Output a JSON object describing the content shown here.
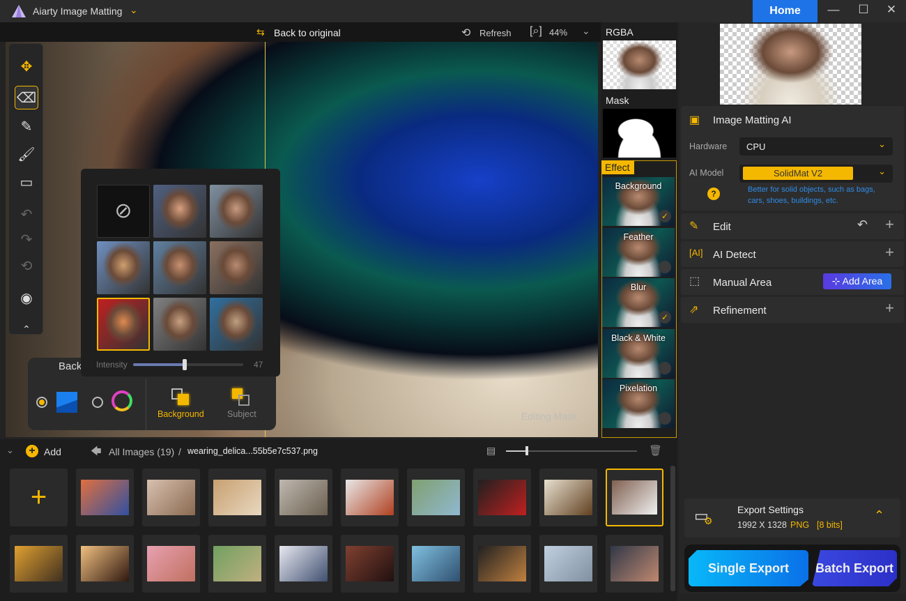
{
  "app": {
    "title": "Aiarty Image Matting",
    "home": "Home",
    "accent": "#f5b800",
    "home_color": "#1e74e6"
  },
  "canvas_bar": {
    "back": "Back to original",
    "refresh": "Refresh",
    "zoom": "44%"
  },
  "canvas": {
    "watermark": "Editing Mask"
  },
  "effect_popup": {
    "intensity_label": "Intensity",
    "intensity_value": "47",
    "intensity_fraction": 0.47
  },
  "bg_panel": {
    "title": "Back",
    "background": "Background",
    "subject": "Subject"
  },
  "effects": {
    "rgba": "RGBA",
    "mask": "Mask",
    "effect": "Effect",
    "items": [
      {
        "label": "Background",
        "checked": true
      },
      {
        "label": "Feather",
        "checked": false
      },
      {
        "label": "Blur",
        "checked": true
      },
      {
        "label": "Black & White",
        "checked": false
      },
      {
        "label": "Pixelation",
        "checked": false
      }
    ]
  },
  "right": {
    "matting": {
      "title": "Image Matting AI",
      "hardware_label": "Hardware",
      "hardware": "CPU",
      "model_label": "AI Model",
      "model": "SolidMat  V2",
      "help": "?",
      "desc": "Better for solid objects, such as bags, cars, shoes, buildings, etc."
    },
    "edit": "Edit",
    "ai_detect": "AI Detect",
    "manual": "Manual Area",
    "add_area": "Add Area",
    "refinement": "Refinement",
    "export": {
      "title": "Export Settings",
      "size": "1992 X 1328",
      "format": "PNG",
      "bits": "[8 bits]"
    },
    "single": "Single Export",
    "batch": "Batch Export"
  },
  "strip": {
    "add": "Add",
    "all_images": "All Images (19)",
    "sep": "/",
    "file": "wearing_delica...55b5e7c537.png",
    "thumbs": [
      [
        "#e07040",
        "#3050a0"
      ],
      [
        "#d8c0b0",
        "#8a6a50"
      ],
      [
        "#c8a070",
        "#e8d8c0"
      ],
      [
        "#c0b8b0",
        "#6a6050"
      ],
      [
        "#e8e8e8",
        "#b04020"
      ],
      [
        "#80a070",
        "#90b8d0"
      ],
      [
        "#202020",
        "#c02020"
      ],
      [
        "#e8e0d0",
        "#604020"
      ],
      [
        "#806050",
        "#f0f0f0"
      ],
      [
        "#e0a030",
        "#403020"
      ],
      [
        "#f0c080",
        "#301810"
      ],
      [
        "#e8a0b0",
        "#c07060"
      ],
      [
        "#70a060",
        "#c0b080"
      ],
      [
        "#e8e8f0",
        "#405070"
      ],
      [
        "#804030",
        "#201010"
      ],
      [
        "#80c0e0",
        "#305070"
      ],
      [
        "#202020",
        "#c08040"
      ],
      [
        "#c0d0e0",
        "#8090a0"
      ],
      [
        "#303848",
        "#c08870"
      ]
    ]
  }
}
